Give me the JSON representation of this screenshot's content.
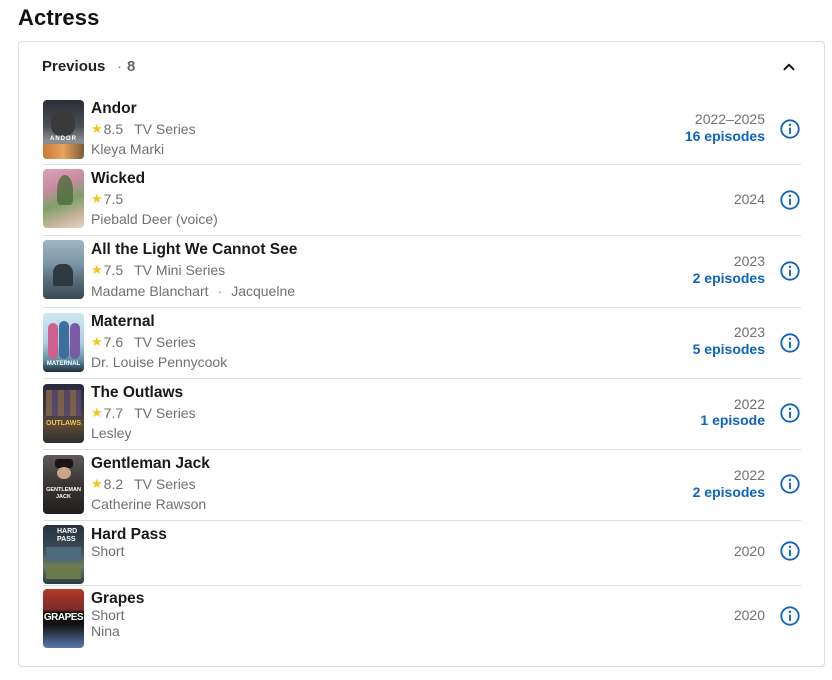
{
  "section": {
    "title": "Actress"
  },
  "card": {
    "label": "Previous",
    "separator": "·",
    "count": "8"
  },
  "colors": {
    "accent": "#0e63be",
    "star": "#f5c518",
    "muted": "#707070"
  },
  "credits": [
    {
      "title": "Andor",
      "rating": "8.5",
      "type": "TV Series",
      "roles": [
        "Kleya Marki"
      ],
      "year": "2022–2025",
      "episodes": "16 episodes",
      "poster_caption": "ANDOR"
    },
    {
      "title": "Wicked",
      "rating": "7.5",
      "type": "",
      "roles": [
        "Piebald Deer (voice)"
      ],
      "year": "2024",
      "episodes": "",
      "poster_caption": ""
    },
    {
      "title": "All the Light We Cannot See",
      "rating": "7.5",
      "type": "TV Mini Series",
      "roles": [
        "Madame Blanchart",
        "Jacquelne"
      ],
      "year": "2023",
      "episodes": "2 episodes",
      "poster_caption": ""
    },
    {
      "title": "Maternal",
      "rating": "7.6",
      "type": "TV Series",
      "roles": [
        "Dr. Louise Pennycook"
      ],
      "year": "2023",
      "episodes": "5 episodes",
      "poster_caption": "MATERNAL"
    },
    {
      "title": "The Outlaws",
      "rating": "7.7",
      "type": "TV Series",
      "roles": [
        "Lesley"
      ],
      "year": "2022",
      "episodes": "1 episode",
      "poster_caption": "OUTLAWS"
    },
    {
      "title": "Gentleman Jack",
      "rating": "8.2",
      "type": "TV Series",
      "roles": [
        "Catherine Rawson"
      ],
      "year": "2022",
      "episodes": "2 episodes",
      "poster_caption": "GENTLEMAN JACK"
    },
    {
      "title": "Hard Pass",
      "rating": "",
      "type": "Short",
      "roles": [],
      "year": "2020",
      "episodes": "",
      "poster_caption": "HARD PASS"
    },
    {
      "title": "Grapes",
      "rating": "",
      "type": "Short",
      "roles": [
        "Nina"
      ],
      "year": "2020",
      "episodes": "",
      "poster_caption": "GRAPES"
    }
  ]
}
